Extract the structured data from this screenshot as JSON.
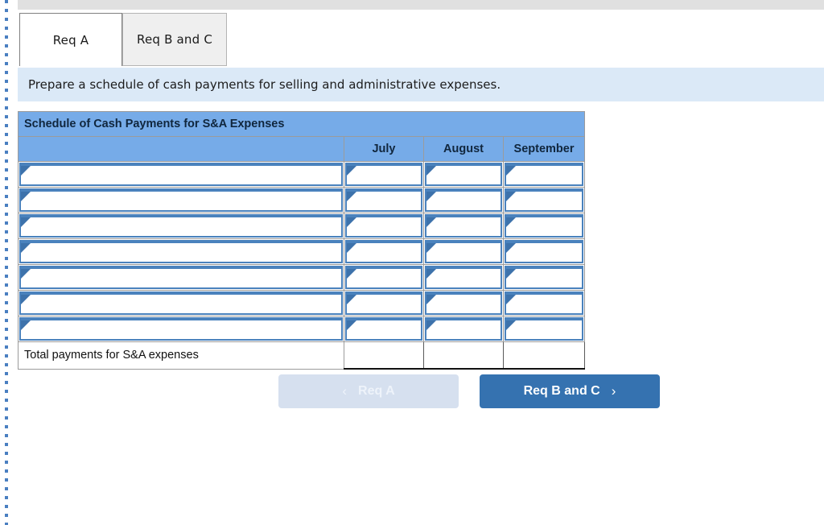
{
  "tabs": [
    {
      "label": "Req A",
      "state": "active"
    },
    {
      "label": "Req B and C",
      "state": "inactive"
    }
  ],
  "instruction": {
    "text": "Prepare a schedule of cash payments for selling and administrative expenses."
  },
  "schedule": {
    "title": "Schedule of Cash Payments for S&A Expenses",
    "columns": [
      "",
      "July",
      "August",
      "September"
    ],
    "entry_rows": [
      {
        "label": "",
        "july": "",
        "august": "",
        "september": ""
      },
      {
        "label": "",
        "july": "",
        "august": "",
        "september": ""
      },
      {
        "label": "",
        "july": "",
        "august": "",
        "september": ""
      },
      {
        "label": "",
        "july": "",
        "august": "",
        "september": ""
      },
      {
        "label": "",
        "july": "",
        "august": "",
        "september": ""
      },
      {
        "label": "",
        "july": "",
        "august": "",
        "september": ""
      },
      {
        "label": "",
        "july": "",
        "august": "",
        "september": ""
      }
    ],
    "total_row": {
      "label": "Total payments for S&A expenses",
      "july": "",
      "august": "",
      "september": ""
    }
  },
  "nav": {
    "prev_label": "Req A",
    "prev_icon": "chevron-left-icon",
    "prev_glyph": "‹",
    "next_label": "Req B and C",
    "next_icon": "chevron-right-icon",
    "next_glyph": "›"
  },
  "colors": {
    "table_header_blue": "#76abe8",
    "entry_border_blue": "#4a82bd",
    "banner_blue": "#dbe9f7",
    "button_active_blue": "#3572b0",
    "button_disabled_blue": "#d6e0ef",
    "topbar_grey": "#e0e0e0"
  }
}
